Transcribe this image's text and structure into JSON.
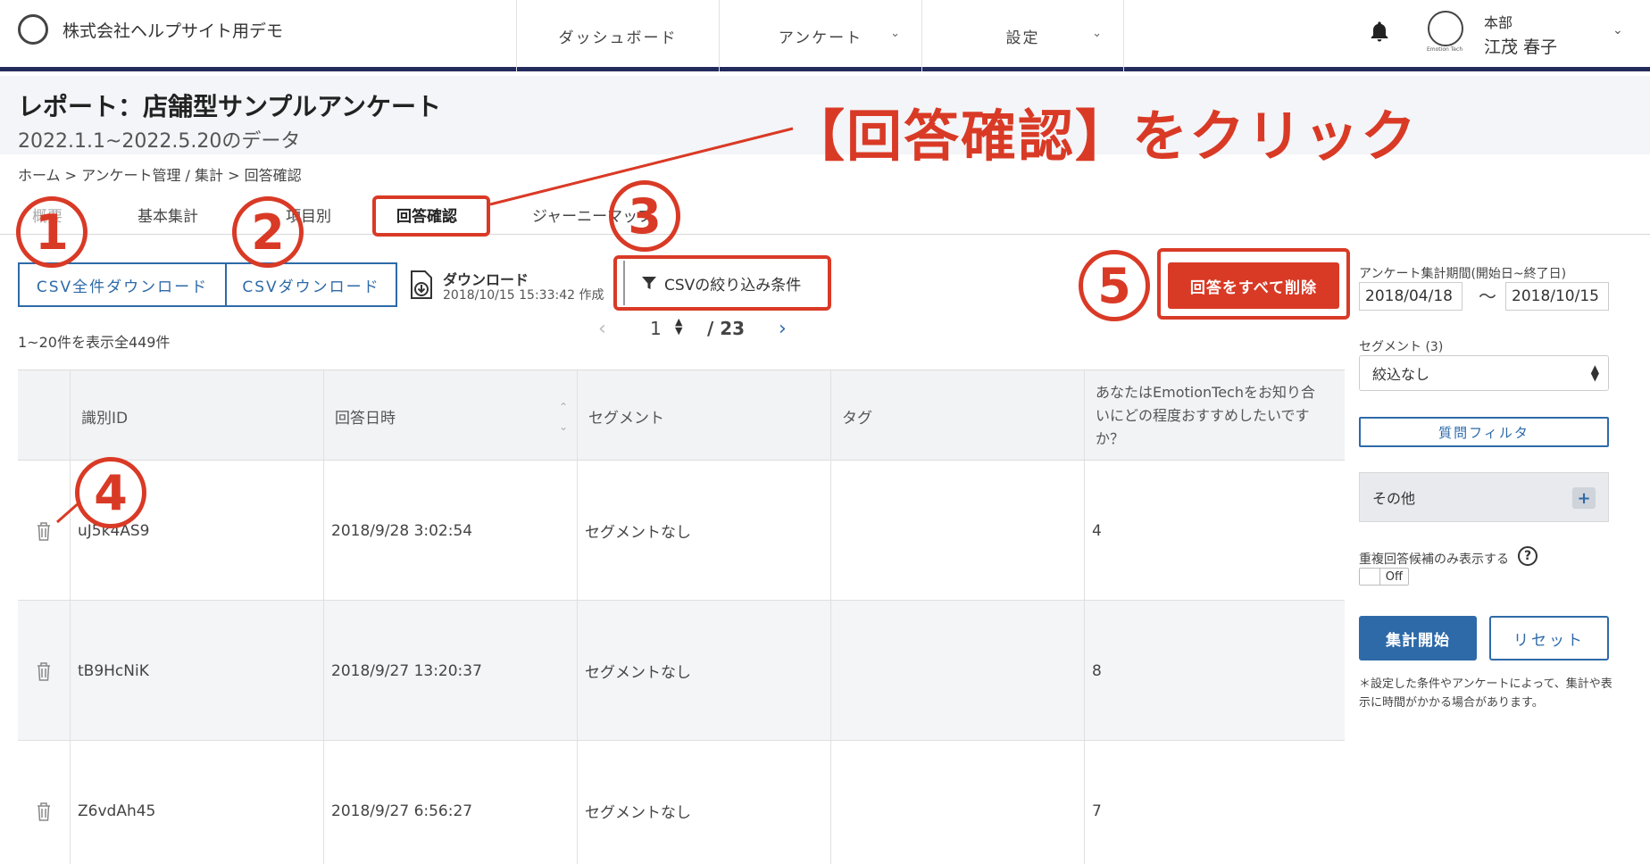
{
  "header": {
    "company": "株式会社ヘルプサイト用デモ",
    "nav": [
      {
        "label": "ダッシュボード",
        "has_menu": false
      },
      {
        "label": "アンケート",
        "has_menu": true
      },
      {
        "label": "設定",
        "has_menu": true
      }
    ],
    "avatar_caption": "Emotion Tech",
    "user_org": "本部",
    "user_name": "江茂 春子"
  },
  "page": {
    "title": "レポート：店舗型サンプルアンケート",
    "subtitle": "2022.1.1~2022.5.20のデータ",
    "breadcrumb": "ホーム > アンケート管理 / 集計 > 回答確認"
  },
  "annotation": {
    "headline": "【回答確認】をクリック",
    "markers": [
      "1",
      "2",
      "3",
      "4",
      "5"
    ]
  },
  "tabs": [
    {
      "label": "概要",
      "active": false
    },
    {
      "label": "基本集計",
      "active": false
    },
    {
      "label": "項目別",
      "active": false
    },
    {
      "label": "回答確認",
      "active": true
    },
    {
      "label": "ジャーニーマップ",
      "active": false
    }
  ],
  "toolbar": {
    "csv_all": "CSV全件ダウンロード",
    "csv_download": "CSVダウンロード",
    "download_label": "ダウンロード",
    "download_time": "2018/10/15 15:33:42 作成",
    "csv_filter": "CSVの絞り込み条件",
    "delete_all": "回答をすべて削除"
  },
  "results": {
    "count_text": "1~20件を表示全449件",
    "current_page": "1",
    "total_pages": "/ 23"
  },
  "table": {
    "columns": [
      "識別ID",
      "回答日時",
      "セグメント",
      "タグ",
      "あなたはEmotionTechをお知り合いにどの程度おすすめしたいですか？"
    ],
    "rows": [
      {
        "id": "uJ5k4AS9",
        "datetime": "2018/9/28 3:02:54",
        "segment": "セグメントなし",
        "tag": "",
        "score": "4"
      },
      {
        "id": "tB9HcNiK",
        "datetime": "2018/9/27 13:20:37",
        "segment": "セグメントなし",
        "tag": "",
        "score": "8"
      },
      {
        "id": "Z6vdAh45",
        "datetime": "2018/9/27 6:56:27",
        "segment": "セグメントなし",
        "tag": "",
        "score": "7"
      }
    ]
  },
  "sidebar": {
    "period_label": "アンケート集計期間(開始日~終了日)",
    "start_date": "2018/04/18",
    "range_sep": "〜",
    "end_date": "2018/10/15",
    "segment_label": "セグメント (3)",
    "segment_value": "絞込なし",
    "question_filter": "質問フィルタ",
    "other": "その他",
    "duplicate_label": "重複回答候補のみ表示する",
    "toggle_value": "Off",
    "start_button": "集計開始",
    "reset_button": "リセット",
    "note": "＊設定した条件やアンケートによって、集計や表示に時間がかかる場合があります。"
  },
  "colors": {
    "accent_red": "#d93a26",
    "primary_blue": "#2e6aa8",
    "header_rule": "#232a5c"
  }
}
